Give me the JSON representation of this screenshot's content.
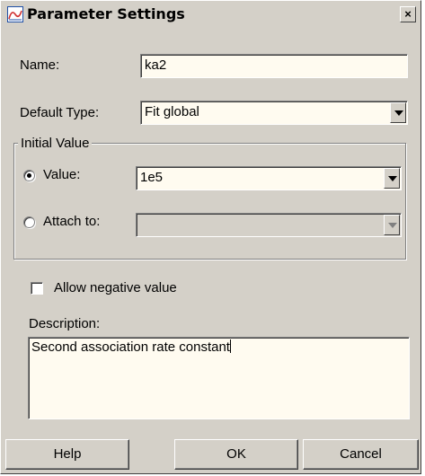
{
  "window": {
    "title": "Parameter Settings",
    "close_glyph": "×"
  },
  "name_field": {
    "label": "Name:",
    "value": "ka2"
  },
  "default_type": {
    "label": "Default Type:",
    "value": "Fit global"
  },
  "initial_value": {
    "group_title": "Initial Value",
    "value_option": {
      "label": "Value:",
      "selected": true,
      "value": "1e5"
    },
    "attach_option": {
      "label": "Attach to:",
      "selected": false,
      "value": ""
    }
  },
  "allow_negative": {
    "label": "Allow negative value",
    "checked": false
  },
  "description": {
    "label": "Description:",
    "value": "Second association rate constant"
  },
  "buttons": {
    "help": "Help",
    "ok": "OK",
    "cancel": "Cancel"
  },
  "icons": {
    "app_icon": "chart-app-icon",
    "dropdown": "chevron-down-icon",
    "close": "close-icon"
  },
  "colors": {
    "face": "#d4d0c8",
    "field_bg": "#fffbf0"
  }
}
